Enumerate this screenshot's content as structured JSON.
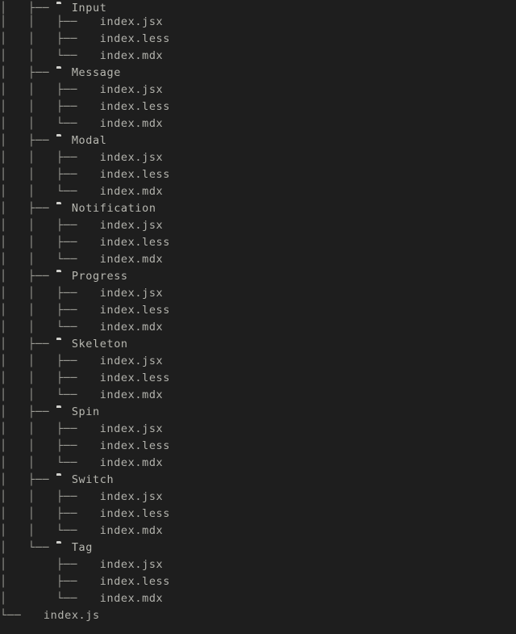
{
  "view": {
    "type": "directory-tree",
    "background_color": "#1e1e1e",
    "text_color": "#b3b3ad",
    "guide_color": "#9a9a94",
    "folder_icon_color": "#c9c9c6",
    "file_icon_color": "#c9a06a",
    "folder_icon_name": "folder-icon",
    "file_icon_name": "file-icon"
  },
  "rows": [
    {
      "guides": "│   ├── ",
      "icon": "folder",
      "label": "Input",
      "depth": 2,
      "kind": "folder"
    },
    {
      "guides": "│   │   ├── ",
      "icon": "file",
      "label": "index.jsx",
      "depth": 3,
      "kind": "file"
    },
    {
      "guides": "│   │   ├── ",
      "icon": "file",
      "label": "index.less",
      "depth": 3,
      "kind": "file"
    },
    {
      "guides": "│   │   └── ",
      "icon": "file",
      "label": "index.mdx",
      "depth": 3,
      "kind": "file"
    },
    {
      "guides": "│   ├── ",
      "icon": "folder",
      "label": "Message",
      "depth": 2,
      "kind": "folder"
    },
    {
      "guides": "│   │   ├── ",
      "icon": "file",
      "label": "index.jsx",
      "depth": 3,
      "kind": "file"
    },
    {
      "guides": "│   │   ├── ",
      "icon": "file",
      "label": "index.less",
      "depth": 3,
      "kind": "file"
    },
    {
      "guides": "│   │   └── ",
      "icon": "file",
      "label": "index.mdx",
      "depth": 3,
      "kind": "file"
    },
    {
      "guides": "│   ├── ",
      "icon": "folder",
      "label": "Modal",
      "depth": 2,
      "kind": "folder"
    },
    {
      "guides": "│   │   ├── ",
      "icon": "file",
      "label": "index.jsx",
      "depth": 3,
      "kind": "file"
    },
    {
      "guides": "│   │   ├── ",
      "icon": "file",
      "label": "index.less",
      "depth": 3,
      "kind": "file"
    },
    {
      "guides": "│   │   └── ",
      "icon": "file",
      "label": "index.mdx",
      "depth": 3,
      "kind": "file"
    },
    {
      "guides": "│   ├── ",
      "icon": "folder",
      "label": "Notification",
      "depth": 2,
      "kind": "folder"
    },
    {
      "guides": "│   │   ├── ",
      "icon": "file",
      "label": "index.jsx",
      "depth": 3,
      "kind": "file"
    },
    {
      "guides": "│   │   ├── ",
      "icon": "file",
      "label": "index.less",
      "depth": 3,
      "kind": "file"
    },
    {
      "guides": "│   │   └── ",
      "icon": "file",
      "label": "index.mdx",
      "depth": 3,
      "kind": "file"
    },
    {
      "guides": "│   ├── ",
      "icon": "folder",
      "label": "Progress",
      "depth": 2,
      "kind": "folder"
    },
    {
      "guides": "│   │   ├── ",
      "icon": "file",
      "label": "index.jsx",
      "depth": 3,
      "kind": "file"
    },
    {
      "guides": "│   │   ├── ",
      "icon": "file",
      "label": "index.less",
      "depth": 3,
      "kind": "file"
    },
    {
      "guides": "│   │   └── ",
      "icon": "file",
      "label": "index.mdx",
      "depth": 3,
      "kind": "file"
    },
    {
      "guides": "│   ├── ",
      "icon": "folder",
      "label": "Skeleton",
      "depth": 2,
      "kind": "folder"
    },
    {
      "guides": "│   │   ├── ",
      "icon": "file",
      "label": "index.jsx",
      "depth": 3,
      "kind": "file"
    },
    {
      "guides": "│   │   ├── ",
      "icon": "file",
      "label": "index.less",
      "depth": 3,
      "kind": "file"
    },
    {
      "guides": "│   │   └── ",
      "icon": "file",
      "label": "index.mdx",
      "depth": 3,
      "kind": "file"
    },
    {
      "guides": "│   ├── ",
      "icon": "folder",
      "label": "Spin",
      "depth": 2,
      "kind": "folder"
    },
    {
      "guides": "│   │   ├── ",
      "icon": "file",
      "label": "index.jsx",
      "depth": 3,
      "kind": "file"
    },
    {
      "guides": "│   │   ├── ",
      "icon": "file",
      "label": "index.less",
      "depth": 3,
      "kind": "file"
    },
    {
      "guides": "│   │   └── ",
      "icon": "file",
      "label": "index.mdx",
      "depth": 3,
      "kind": "file"
    },
    {
      "guides": "│   ├── ",
      "icon": "folder",
      "label": "Switch",
      "depth": 2,
      "kind": "folder"
    },
    {
      "guides": "│   │   ├── ",
      "icon": "file",
      "label": "index.jsx",
      "depth": 3,
      "kind": "file"
    },
    {
      "guides": "│   │   ├── ",
      "icon": "file",
      "label": "index.less",
      "depth": 3,
      "kind": "file"
    },
    {
      "guides": "│   │   └── ",
      "icon": "file",
      "label": "index.mdx",
      "depth": 3,
      "kind": "file"
    },
    {
      "guides": "│   └── ",
      "icon": "folder",
      "label": "Tag",
      "depth": 2,
      "kind": "folder"
    },
    {
      "guides": "│       ├── ",
      "icon": "file",
      "label": "index.jsx",
      "depth": 3,
      "kind": "file"
    },
    {
      "guides": "│       ├── ",
      "icon": "file",
      "label": "index.less",
      "depth": 3,
      "kind": "file"
    },
    {
      "guides": "│       └── ",
      "icon": "file",
      "label": "index.mdx",
      "depth": 3,
      "kind": "file"
    },
    {
      "guides": "└── ",
      "icon": "file",
      "label": "index.js",
      "depth": 1,
      "kind": "file"
    }
  ]
}
